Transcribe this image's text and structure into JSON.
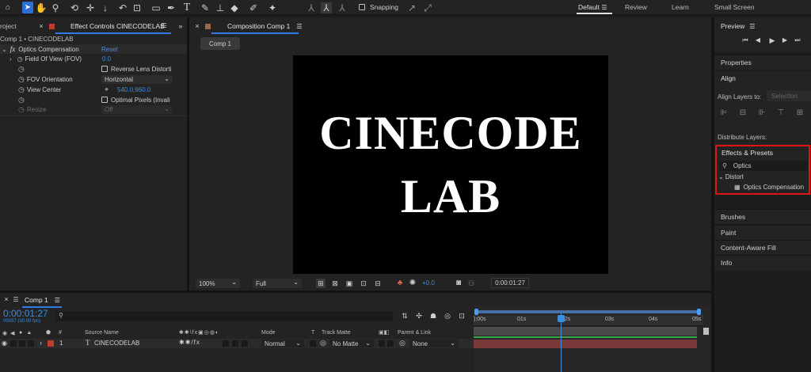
{
  "toolbar": {
    "snapping_label": "Snapping",
    "workspaces": [
      "Default",
      "Review",
      "Learn",
      "Small Screen"
    ]
  },
  "project_tab": "roject",
  "effect_controls": {
    "tab_label": "Effect Controls CINECODELAB",
    "breadcrumb": "Comp 1 • CINECODELAB",
    "fx_label": "fx",
    "effect_name": "Optics Compensation",
    "reset_label": "Reset",
    "fov_label": "Field Of View (FOV)",
    "fov_value": "0.0",
    "reverse_label": "Reverse Lens Distorti",
    "orientation_label": "FOV Orientation",
    "orientation_value": "Horizontal",
    "view_center_label": "View Center",
    "view_center_value": "540.0,960.0",
    "optimal_label": "Optimal Pixels (Invali",
    "resize_label": "Resize",
    "resize_value": "Off"
  },
  "composition": {
    "tab_label": "Composition Comp 1",
    "subtab": "Comp 1",
    "canvas_line1": "CINECODE",
    "canvas_line2": "LAB",
    "zoom": "100%",
    "resolution": "Full",
    "exposure": "+0.0",
    "timecode": "0:00:01:27"
  },
  "right_panel": {
    "preview_label": "Preview",
    "properties_label": "Properties",
    "align_label": "Align",
    "align_to_label": "Align Layers to:",
    "align_to_value": "Selection",
    "distribute_label": "Distribute Layers:",
    "effects_label": "Effects & Presets",
    "search_value": "Optics",
    "category": "Distort",
    "effect_item": "Optics Compensation",
    "items": [
      "Brushes",
      "Paint",
      "Content-Aware Fill",
      "Info"
    ]
  },
  "timeline": {
    "tab_label": "Comp 1",
    "timecode": "0:00:01:27",
    "frames": "00057 (30.00 fps)",
    "headers": {
      "hash": "#",
      "source": "Source Name",
      "mode": "Mode",
      "t": "T",
      "track_matte": "Track Matte",
      "parent": "Parent & Link"
    },
    "layer": {
      "index": "1",
      "type": "T",
      "name": "CINECODELAB",
      "mode": "Normal",
      "matte": "No Matte",
      "parent": "None"
    },
    "ruler": [
      "):00s",
      "01s",
      "02s",
      "03s",
      "04s",
      "05s"
    ]
  },
  "colors": {
    "accent": "#3d8ee0",
    "highlight_box": "#e01515",
    "layer_bar": "#7a3a3a",
    "label_red": "#c0392b"
  }
}
